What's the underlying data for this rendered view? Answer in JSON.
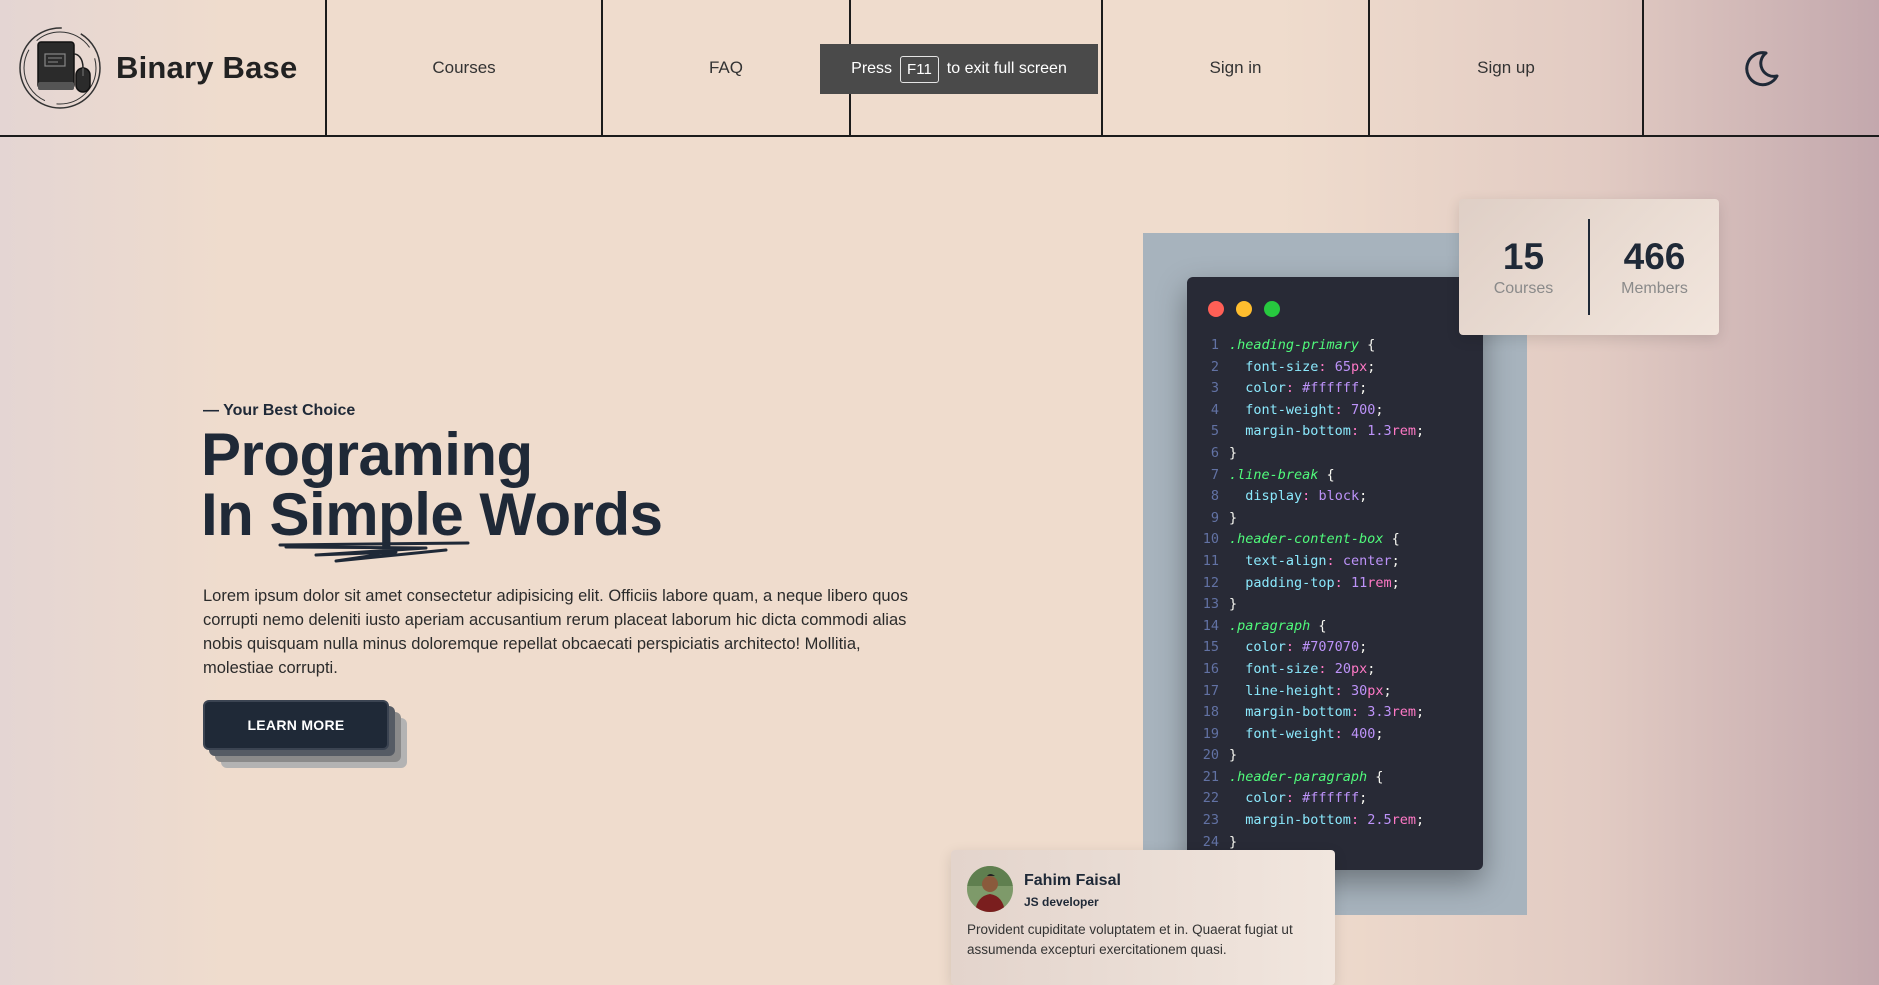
{
  "brand": {
    "name": "Binary Base"
  },
  "nav": {
    "items": [
      "Courses",
      "FAQ",
      "",
      "Sign in",
      "Sign up"
    ]
  },
  "fullscreen_toast": {
    "prefix": "Press",
    "key": "F11",
    "suffix": "to exit full screen"
  },
  "hero": {
    "eyebrow": "— Your Best Choice",
    "heading_line1": "Programing",
    "heading_line2_pre": "In ",
    "heading_line2_word": "Simple",
    "heading_line2_post": " Words",
    "paragraph": "Lorem ipsum dolor sit amet consectetur adipisicing elit. Officiis labore quam, a neque libero quos corrupti nemo deleniti iusto aperiam accusantium rerum placeat laborum hic dicta commodi alias nobis quisquam nulla minus doloremque repellat obcaecati perspiciatis architecto! Mollitia, molestiae corrupti.",
    "button_label": "LEARN MORE"
  },
  "stats": [
    {
      "value": "15",
      "label": "Courses"
    },
    {
      "value": "466",
      "label": "Members"
    }
  ],
  "code": {
    "lines": [
      ".heading-primary {",
      "  font-size: 65px;",
      "  color: #ffffff;",
      "  font-weight: 700;",
      "  margin-bottom: 1.3rem;",
      "}",
      ".line-break {",
      "  display: block;",
      "}",
      ".header-content-box {",
      "  text-align: center;",
      "  padding-top: 11rem;",
      "}",
      ".paragraph {",
      "  color: #707070;",
      "  font-size: 20px;",
      "  line-height: 30px;",
      "  margin-bottom: 3.3rem;",
      "  font-weight: 400;",
      "}",
      ".header-paragraph {",
      "  color: #ffffff;",
      "  margin-bottom: 2.5rem;",
      "}"
    ]
  },
  "testimonial": {
    "name": "Fahim Faisal",
    "role": "JS developer",
    "quote": "Provident cupiditate voluptatem et in. Quaerat fugiat ut assumenda excepturi exercitationem quasi."
  },
  "icons": {
    "theme_toggle": "moon-icon",
    "logo": "book-mouse-logo"
  },
  "colors": {
    "dark": "#1f2937",
    "code_bg": "#282a36",
    "selector": "#50fa7b",
    "property": "#8be9fd",
    "value": "#ff79c6",
    "number": "#bd93f9"
  }
}
